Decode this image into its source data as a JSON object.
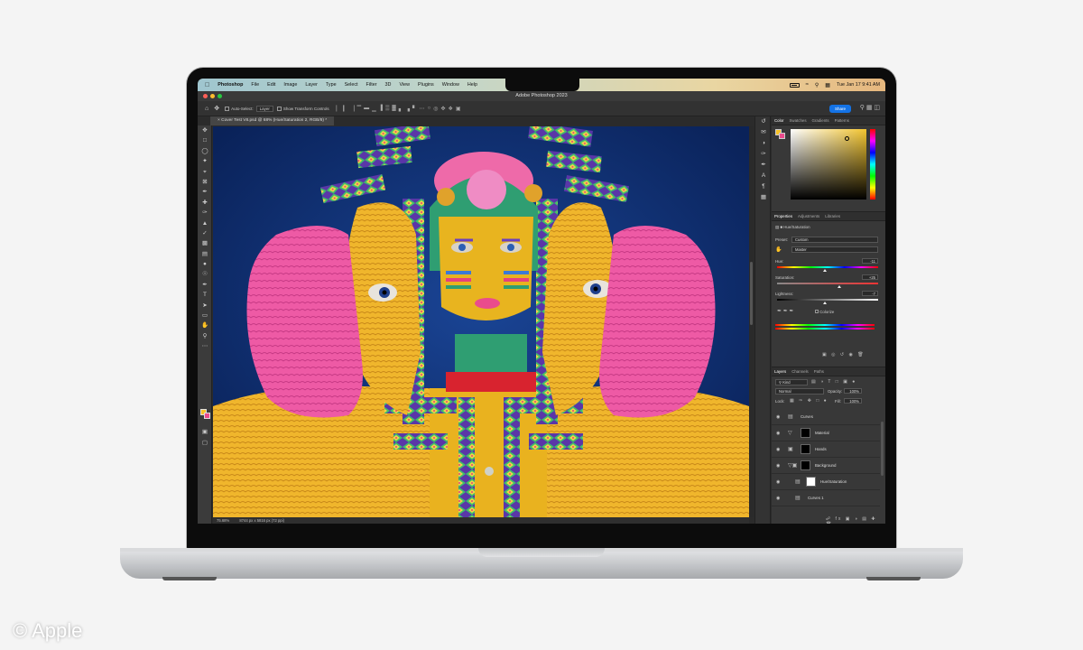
{
  "menubar": {
    "app": "Photoshop",
    "items": [
      "File",
      "Edit",
      "Image",
      "Layer",
      "Type",
      "Select",
      "Filter",
      "3D",
      "View",
      "Plugins",
      "Window",
      "Help"
    ],
    "clock": "Tue Jan 17 9:41 AM"
  },
  "window": {
    "title": "Adobe Photoshop 2023"
  },
  "options": {
    "auto_select_label": "Auto-Select:",
    "auto_select_value": "Layer",
    "transform_label": "Show Transform Controls",
    "share_label": "Share"
  },
  "document": {
    "tab_label": "Cover Test V8.psd @ 68% (Hue/Saturation 2, RGB/8) *"
  },
  "status": {
    "zoom": "75.68%",
    "dimensions": "8744 px x 5816 px (72 ppi)"
  },
  "color_panel": {
    "tabs": [
      "Color",
      "Swatches",
      "Gradients",
      "Patterns"
    ],
    "foreground": "#f6c229",
    "background": "#ea4c8c"
  },
  "properties": {
    "tabs": [
      "Properties",
      "Adjustments",
      "Libraries"
    ],
    "panel_title": "Hue/Saturation",
    "preset_label": "Preset:",
    "preset_value": "Custom",
    "channel_value": "Master",
    "hue_label": "Hue:",
    "hue_value": "-11",
    "hue_fraction": 0.47,
    "saturation_label": "Saturation:",
    "saturation_value": "+25",
    "saturation_fraction": 0.62,
    "lightness_label": "Lightness:",
    "lightness_value": "-7",
    "lightness_fraction": 0.47,
    "colorize_label": "Colorize"
  },
  "layers": {
    "tabs": [
      "Layers",
      "Channels",
      "Paths"
    ],
    "filter_label": "Kind",
    "blend_mode": "Normal",
    "opacity_label": "Opacity:",
    "opacity_value": "100%",
    "lock_label": "Lock:",
    "fill_label": "Fill:",
    "fill_value": "100%",
    "items": [
      {
        "name": "Curves",
        "thumb": "none"
      },
      {
        "name": "Material",
        "thumb": "black"
      },
      {
        "name": "Hands",
        "thumb": "black"
      },
      {
        "name": "Background",
        "thumb": "black"
      },
      {
        "name": "Hue/Saturation",
        "thumb": "white"
      },
      {
        "name": "Curves 1",
        "thumb": "none"
      }
    ]
  },
  "credit": "© Apple"
}
